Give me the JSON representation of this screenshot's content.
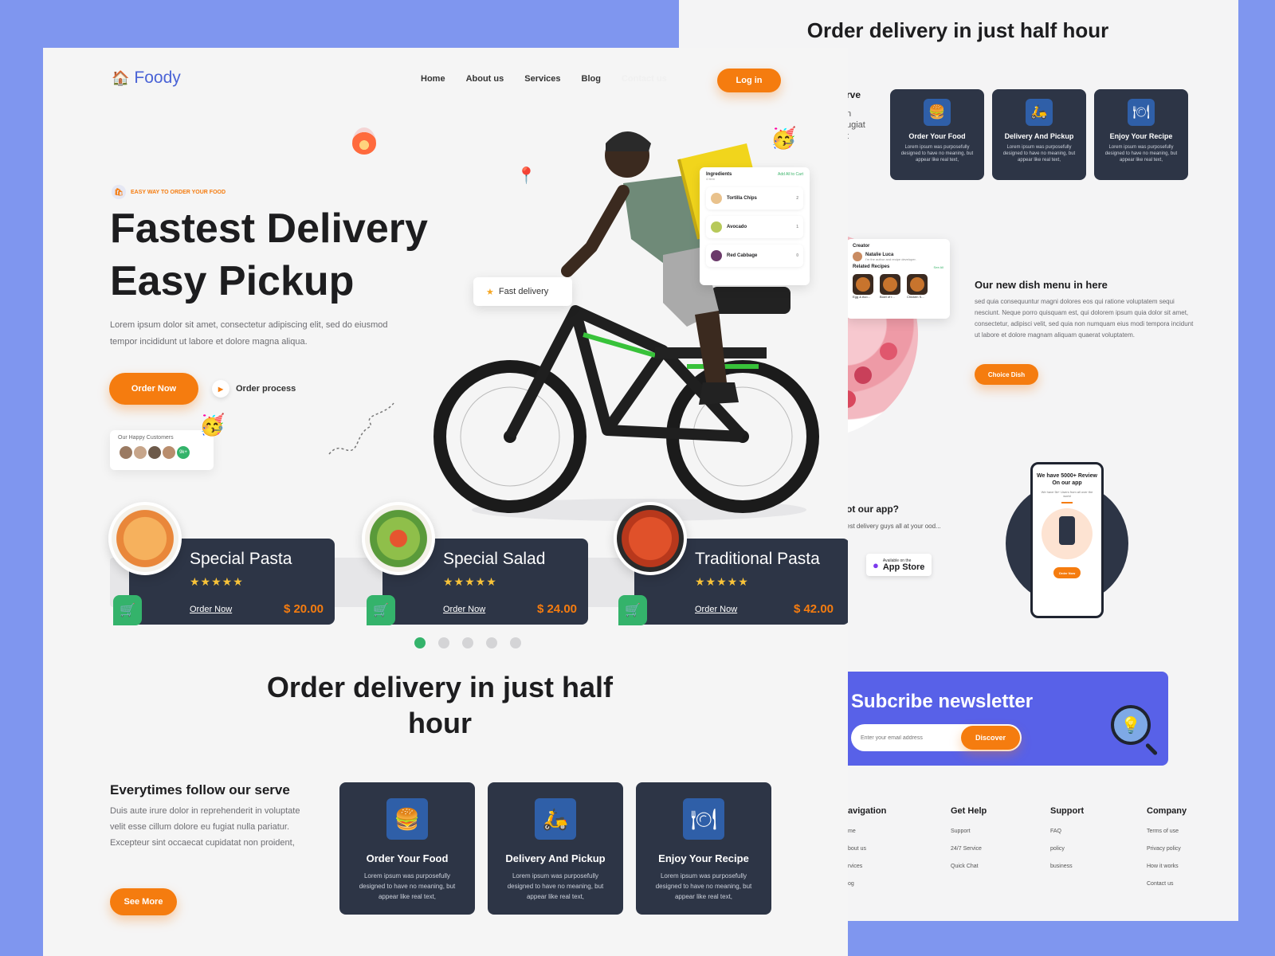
{
  "front": {
    "logo": {
      "text": "Foody"
    },
    "nav": [
      "Home",
      "About us",
      "Services",
      "Blog",
      "Contact us"
    ],
    "login_label": "Log in",
    "eyebrow": "EASY WAY TO ORDER YOUR FOOD",
    "hero_line1_a": "Fastest ",
    "hero_line1_b": "Delivery",
    "hero_line2": "Easy Pickup",
    "hero_desc": "Lorem ipsum dolor sit amet, consectetur adipiscing elit, sed do eiusmod tempor incididunt ut labore et dolore magna aliqua.",
    "order_now_label": "Order Now",
    "order_process_label": "Order process",
    "customers_label": "Our Happy Customers",
    "customers_more": "9k+",
    "fast_delivery_label": "Fast delivery",
    "ingredients": {
      "title": "Ingredients",
      "action": "Add All to Cart",
      "subtitle": "4 Item",
      "items": [
        {
          "name": "Tortilla Chips",
          "qty": "2"
        },
        {
          "name": "Avocado",
          "qty": "1"
        },
        {
          "name": "Red Cabbage",
          "qty": "0"
        }
      ]
    },
    "dishes": [
      {
        "name": "Special Pasta",
        "stars": "★★★★★",
        "order": "Order Now",
        "price": "$ 20.00"
      },
      {
        "name": "Special Salad",
        "stars": "★★★★★",
        "order": "Order Now",
        "price": "$ 24.00"
      },
      {
        "name": "Traditional Pasta",
        "stars": "★★★★★",
        "order": "Order Now",
        "price": "$ 42.00"
      }
    ],
    "carousel": {
      "count": 5,
      "active_index": 0
    },
    "section_title": "Order delivery in just half hour",
    "serve_title": "Everytimes follow our serve",
    "serve_desc": "Duis aute irure dolor in reprehenderit in voluptate velit esse cillum dolore eu fugiat nulla pariatur. Excepteur sint occaecat cupidatat non proident,",
    "see_more_label": "See More",
    "services": [
      {
        "title": "Order Your Food",
        "desc": "Lorem ipsum was purposefully designed to have no meaning, but appear like real text,",
        "icon": "burger-icon"
      },
      {
        "title": "Delivery And Pickup",
        "desc": "Lorem ipsum was purposefully designed to have no meaning, but appear like real text,",
        "icon": "scooter-icon"
      },
      {
        "title": "Enjoy Your Recipe",
        "desc": "Lorem ipsum was purposefully designed to have no meaning, but appear like real text,",
        "icon": "cloche-icon"
      }
    ]
  },
  "back": {
    "title": "Order delivery in just half hour",
    "cut_text": {
      "heading": "rve",
      "lines": [
        "n",
        "ugiat",
        "t"
      ]
    },
    "services": [
      {
        "title": "Order Your Food",
        "desc": "Lorem ipsum was purposefully designed to have no meaning, but appear like real text,"
      },
      {
        "title": "Delivery And Pickup",
        "desc": "Lorem ipsum was purposefully designed to have no meaning, but appear like real text,"
      },
      {
        "title": "Enjoy Your Recipe",
        "desc": "Lorem ipsum was purposefully designed to have no meaning, but appear like real text,"
      }
    ],
    "creator": {
      "heading": "Creator",
      "name": "Natalie Luca",
      "bio": "I'm the author and recipe developer.",
      "related": "Related Recipes",
      "see_all": "See All",
      "recipes": [
        "Egg & Avo...",
        "Bowl of r...",
        "Chicken S..."
      ]
    },
    "menu_title": "Our new dish menu in here",
    "menu_desc": "sed quia consequuntur magni dolores eos qui ratione voluptatem sequi nesciunt. Neque porro quisquam est, qui dolorem ipsum quia dolor sit amet, consectetur, adipisci velit, sed quia non numquam eius modi tempora incidunt ut labore et dolore magnam aliquam quaerat voluptatem.",
    "choice_dish_label": "Choice Dish",
    "app_title": "ot our app?",
    "app_desc": "est delivery guys all at your ood...",
    "app_store_small": "Available on the",
    "app_store_big": "App Store",
    "phone": {
      "title": "We have 5000+ Review On our app",
      "sub": "We have 5k+ Users from all over the world",
      "button": "Order Now"
    },
    "newsletter": {
      "title": "Subcribe newsletter",
      "placeholder": "Enter your email address",
      "button": "Discover"
    },
    "footer": [
      {
        "heading": "avigation",
        "links": [
          "me",
          "bout us",
          "rvices",
          "og"
        ]
      },
      {
        "heading": "Get Help",
        "links": [
          "Support",
          "24/7 Service",
          "Quick Chat"
        ]
      },
      {
        "heading": "Support",
        "links": [
          "FAQ",
          "policy",
          "business"
        ]
      },
      {
        "heading": "Company",
        "links": [
          "Terms of use",
          "Privacy policy",
          "How it works",
          "Contact us"
        ]
      }
    ]
  },
  "colors": {
    "accent": "#f57c0f",
    "dark_card": "#2d3546",
    "green": "#34b36b",
    "brand_blue": "#4a63d6",
    "newsletter": "#5861e8",
    "background": "#7f96ef"
  }
}
